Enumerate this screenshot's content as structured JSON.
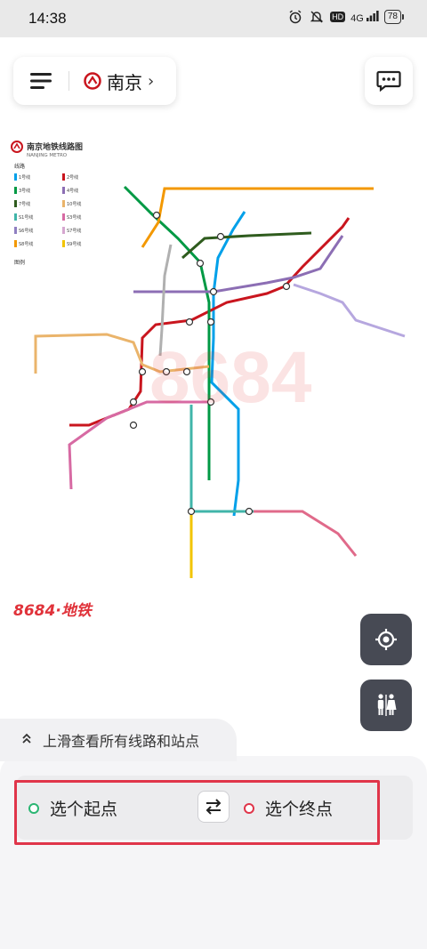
{
  "status_bar": {
    "time": "14:38",
    "icons": [
      "alarm-icon",
      "mute-icon",
      "hd-icon",
      "signal-4g-icon"
    ],
    "hd": "HD",
    "network": "4G",
    "battery": "78"
  },
  "header": {
    "city": "南京",
    "menu_icon": "menu-icon",
    "message_icon": "message-icon"
  },
  "map": {
    "title_zh": "南京地铁线路图",
    "title_en": "NANJING METRO",
    "legend_heading": "线路",
    "legend_heading_2": "图例",
    "lines": [
      {
        "name": "1号线",
        "color": "#00a0e9"
      },
      {
        "name": "2号线",
        "color": "#c9151e"
      },
      {
        "name": "3号线",
        "color": "#009944"
      },
      {
        "name": "4号线",
        "color": "#8c6eb4"
      },
      {
        "name": "7号线",
        "color": "#2f5c1e"
      },
      {
        "name": "10号线",
        "color": "#eab46b"
      },
      {
        "name": "S1号线",
        "color": "#40b5a9"
      },
      {
        "name": "S3号线",
        "color": "#d76aa3"
      },
      {
        "name": "S6号线",
        "color": "#8f7fc1"
      },
      {
        "name": "S7号线",
        "color": "#d6a7d0"
      },
      {
        "name": "S8号线",
        "color": "#f39800"
      },
      {
        "name": "S9号线",
        "color": "#f2c400"
      }
    ],
    "brand": "8684·地铁",
    "watermark": "8684"
  },
  "controls": {
    "locate_icon": "crosshair-icon",
    "wc_icon": "restroom-icon"
  },
  "bottom": {
    "hint": "上滑查看所有线路和站点",
    "from_placeholder": "选个起点",
    "to_placeholder": "选个终点",
    "swap_icon": "swap-icon"
  },
  "colors": {
    "accent_red": "#e0354a",
    "start_green": "#2bb673",
    "control_dark": "#474a54"
  }
}
